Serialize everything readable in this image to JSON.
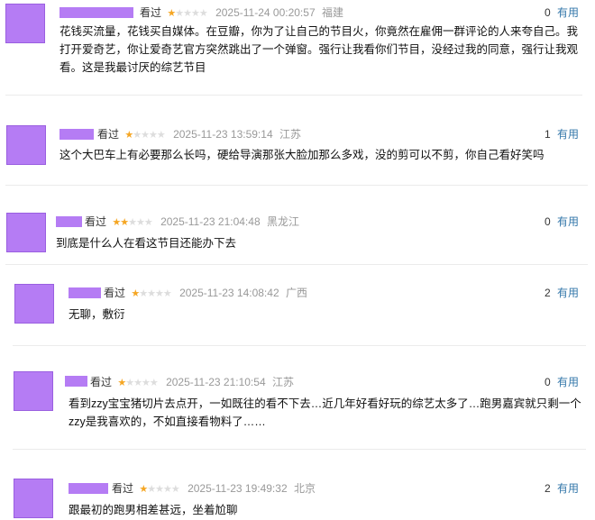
{
  "labels": {
    "watched": "看过",
    "useful": "有用"
  },
  "colors": {
    "star_on": "#f5a623",
    "star_off": "#dddddd",
    "link": "#3377aa",
    "meta_gray": "#999999",
    "avatar_placeholder": "#b57cf4"
  },
  "comments": [
    {
      "rating": 1,
      "time": "2025-11-24 00:20:57",
      "region": "福建",
      "votes": "0",
      "content": "花钱买流量，花钱买自媒体。在豆瓣，你为了让自己的节目火，你竟然在雇佣一群评论的人来夸自己。我打开爱奇艺，你让爱奇艺官方突然跳出了一个弹窗。强行让我看你们节目，没经过我的同意，强行让我观看。这是我最讨厌的综艺节目"
    },
    {
      "rating": 1,
      "time": "2025-11-23 13:59:14",
      "region": "江苏",
      "votes": "1",
      "content": "这个大巴车上有必要那么长吗，硬给导演那张大脸加那么多戏，没的剪可以不剪，你自己看好笑吗"
    },
    {
      "rating": 2,
      "time": "2025-11-23 21:04:48",
      "region": "黑龙江",
      "votes": "0",
      "content": "到底是什么人在看这节目还能办下去"
    },
    {
      "rating": 1,
      "time": "2025-11-23 14:08:42",
      "region": "广西",
      "votes": "2",
      "content": "无聊，敷衍"
    },
    {
      "rating": 1,
      "time": "2025-11-23 21:10:54",
      "region": "江苏",
      "votes": "0",
      "content": "看到zzy宝宝猪切片去点开，一如既往的看不下去…近几年好看好玩的综艺太多了…跑男嘉宾就只剩一个zzy是我喜欢的，不如直接看物料了……"
    },
    {
      "rating": 1,
      "time": "2025-11-23 19:49:32",
      "region": "北京",
      "votes": "2",
      "content": "跟最初的跑男相差甚远，坐着尬聊"
    }
  ]
}
